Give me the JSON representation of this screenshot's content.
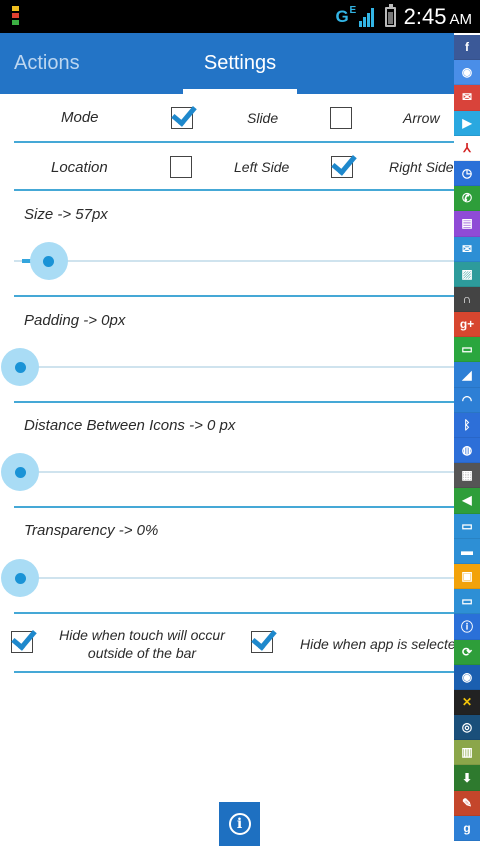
{
  "status_bar": {
    "network_type": "G",
    "network_sub": "E",
    "time": "2:45",
    "ampm": "AM",
    "colors": {
      "bg": "#000000",
      "accent": "#33b5e5"
    }
  },
  "tabs": {
    "actions_label": "Actions",
    "settings_label": "Settings",
    "active": "Settings"
  },
  "mode_row": {
    "label": "Mode",
    "slide_label": "Slide",
    "slide_checked": true,
    "arrow_label": "Arrow",
    "arrow_checked": false
  },
  "location_row": {
    "label": "Location",
    "left_label": "Left Side",
    "left_checked": false,
    "right_label": "Right Side",
    "right_checked": true
  },
  "sliders": [
    {
      "label": "Size -> 57px",
      "fraction": 0.06
    },
    {
      "label": "Padding -> 0px",
      "fraction": 0.0
    },
    {
      "label": "Distance Between Icons -> 0 px",
      "fraction": 0.0
    },
    {
      "label": "Transparency -> 0%",
      "fraction": 0.0
    }
  ],
  "hide_options": {
    "touch_outside_label": "Hide when touch will occur\noutside of the bar",
    "touch_outside_checked": true,
    "app_selected_label": "Hide when app is selected",
    "app_selected_checked": true
  },
  "info_button": {
    "icon": "info-icon",
    "glyph": "i"
  },
  "side_bar_icons": [
    {
      "name": "facebook-icon",
      "color": "#3b5998",
      "glyph": "f"
    },
    {
      "name": "chrome-icon",
      "color": "#4a8ee8",
      "glyph": "◉"
    },
    {
      "name": "gmail-icon",
      "color": "#d9433a",
      "glyph": "✉"
    },
    {
      "name": "play-store-icon",
      "color": "#2aa8e0",
      "glyph": "▶"
    },
    {
      "name": "adobe-reader-icon",
      "color": "#ffffff",
      "glyph": "⅄",
      "fg": "#d32222"
    },
    {
      "name": "clock-icon",
      "color": "#2a70d8",
      "glyph": "◷"
    },
    {
      "name": "phone-icon",
      "color": "#2e9e3a",
      "glyph": "✆"
    },
    {
      "name": "contacts-icon",
      "color": "#8f4bd6",
      "glyph": "▤"
    },
    {
      "name": "email-icon",
      "color": "#2d8fd5",
      "glyph": "✉"
    },
    {
      "name": "gallery-icon",
      "color": "#2d9b9b",
      "glyph": "▨"
    },
    {
      "name": "headphones-icon",
      "color": "#444444",
      "glyph": "∩"
    },
    {
      "name": "google-plus-icon",
      "color": "#d7462f",
      "glyph": "g+"
    },
    {
      "name": "messaging-icon",
      "color": "#2aa63e",
      "glyph": "▭"
    },
    {
      "name": "signal-icon",
      "color": "#2d7fd5",
      "glyph": "◢"
    },
    {
      "name": "wifi-icon",
      "color": "#2d7fd5",
      "glyph": "◠"
    },
    {
      "name": "bluetooth-icon",
      "color": "#2d6fd8",
      "glyph": "ᛒ"
    },
    {
      "name": "browser-icon",
      "color": "#2d6fd8",
      "glyph": "◍"
    },
    {
      "name": "calculator-icon",
      "color": "#555555",
      "glyph": "▦"
    },
    {
      "name": "volume-icon",
      "color": "#2e9e3a",
      "glyph": "◀"
    },
    {
      "name": "display-icon",
      "color": "#2d8fd5",
      "glyph": "▭"
    },
    {
      "name": "chat-icon",
      "color": "#2d8fd5",
      "glyph": "▬"
    },
    {
      "name": "lock-icon",
      "color": "#f2a20a",
      "glyph": "▣"
    },
    {
      "name": "keyboard-icon",
      "color": "#2d8fd5",
      "glyph": "▭"
    },
    {
      "name": "info-circle-icon",
      "color": "#2a70d8",
      "glyph": "ⓘ"
    },
    {
      "name": "refresh-icon",
      "color": "#2e9e3a",
      "glyph": "⟳"
    },
    {
      "name": "globe-icon",
      "color": "#1b5fb0",
      "glyph": "◉"
    },
    {
      "name": "xda-icon",
      "color": "#222222",
      "glyph": "✕",
      "fg": "#f2c40a"
    },
    {
      "name": "circle-app-icon",
      "color": "#1a4f7a",
      "glyph": "◎"
    },
    {
      "name": "maps-icon",
      "color": "#8ba64a",
      "glyph": "▥"
    },
    {
      "name": "download-icon",
      "color": "#2e7a2e",
      "glyph": "⬇"
    },
    {
      "name": "notes-icon",
      "color": "#c4462b",
      "glyph": "✎"
    },
    {
      "name": "google-search-icon",
      "color": "#2d7fd5",
      "glyph": "g"
    }
  ],
  "colors": {
    "action_bar": "#2374c6",
    "divider": "#45a8d6",
    "checkmark": "#1e88cc",
    "slider_thumb": "#1a93d6",
    "slider_halo": "#a9dcf5"
  }
}
